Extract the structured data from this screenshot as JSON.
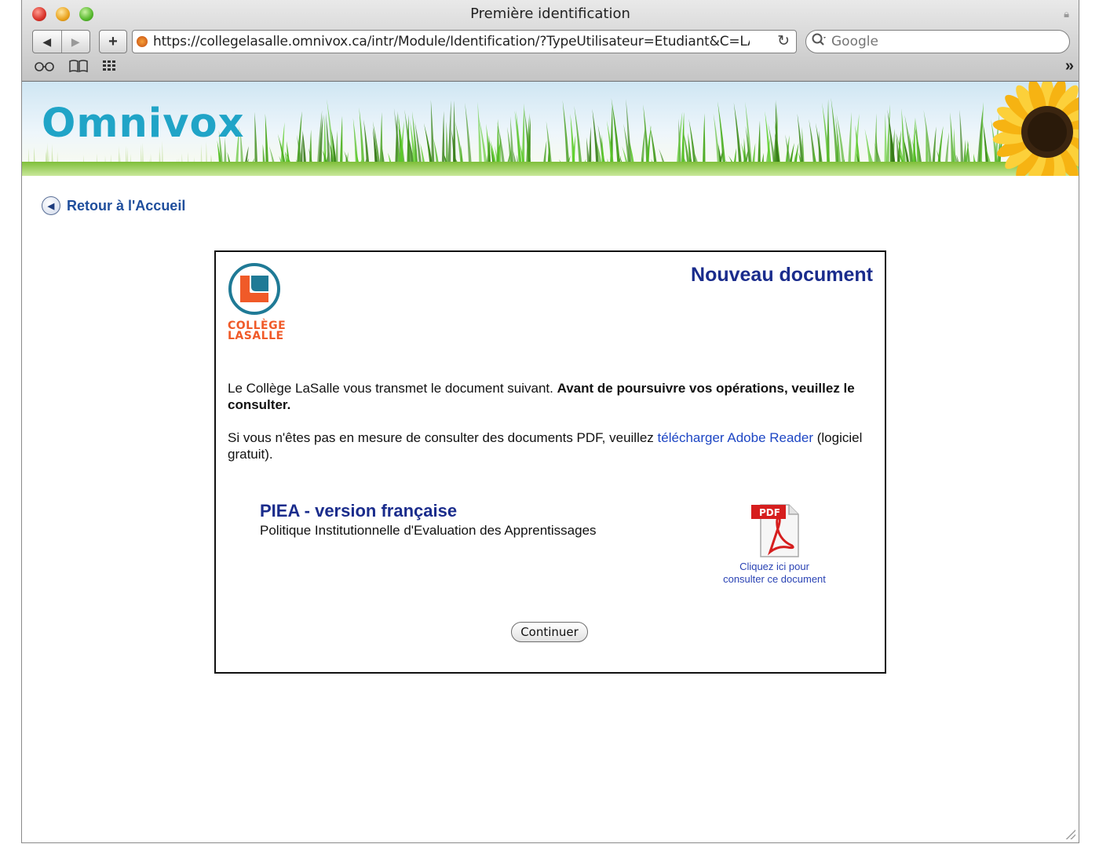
{
  "window": {
    "title": "Première identification",
    "url": "https://collegelasalle.omnivox.ca/intr/Module/Identification/?TypeUtilisateur=Etudiant&C=LAS",
    "search_placeholder": "Google"
  },
  "banner": {
    "logo_text": "Omnivox"
  },
  "nav": {
    "back_label": "Retour à l'Accueil"
  },
  "panel": {
    "title": "Nouveau document",
    "college_logo_line1": "COLLÈGE",
    "college_logo_line2": "LASALLE",
    "intro_plain": "Le Collège LaSalle vous transmet le document suivant. ",
    "intro_bold": "Avant de poursuivre vos opérations, veuillez le consulter.",
    "pdf_notice_before": "Si vous n'êtes pas en mesure de consulter des documents PDF, veuillez ",
    "pdf_notice_link": "télécharger Adobe Reader",
    "pdf_notice_after": " (logiciel gratuit).",
    "document": {
      "title": "PIEA - version française",
      "subtitle": "Politique Institutionnelle d'Evaluation des Apprentissages",
      "pdf_badge": "PDF",
      "pdf_caption_line1": "Cliquez ici pour",
      "pdf_caption_line2": "consulter ce document"
    },
    "continue_label": "Continuer"
  },
  "colors": {
    "accent_title": "#1a2c8c",
    "link": "#1d46c4",
    "omnivox_logo": "#20a4c7",
    "college_orange": "#f05a28",
    "college_teal": "#1f7a96"
  }
}
